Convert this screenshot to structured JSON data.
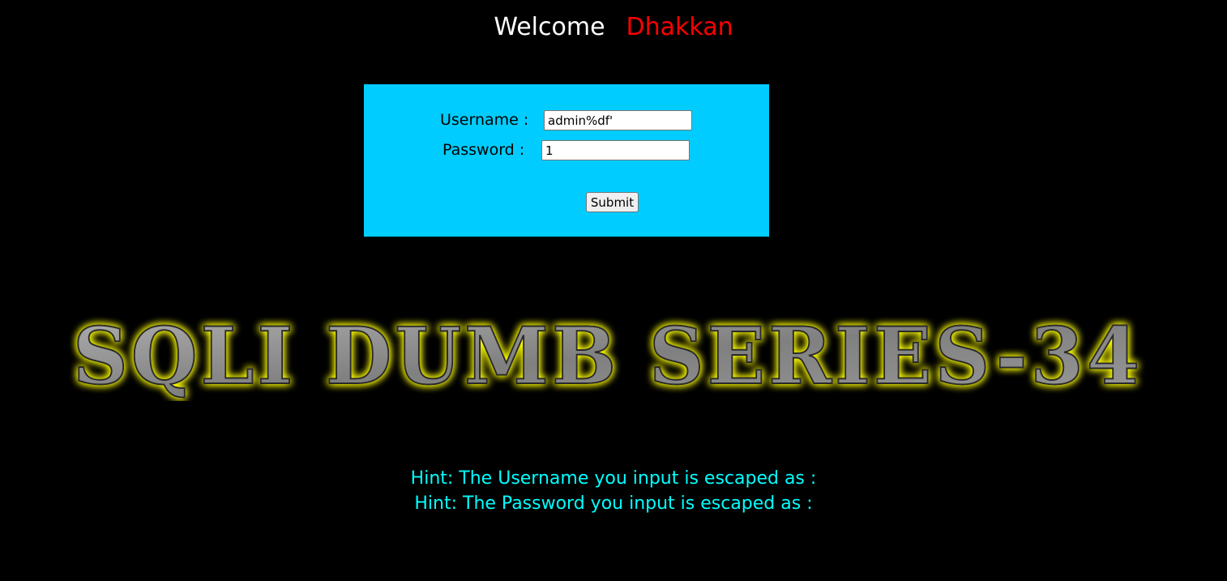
{
  "header": {
    "welcome": "Welcome",
    "name": "Dhakkan"
  },
  "form": {
    "username_label": "Username :",
    "password_label": "Password :",
    "username_value": "admin%df'",
    "password_value": "1",
    "submit_label": "Submit",
    "background_color": "#00ccff"
  },
  "banner": {
    "text": "SQLI DUMB SERIES-34",
    "fill_color": "#8a8a8a",
    "glow_color": "#ffff00"
  },
  "hints": {
    "username_hint": "Hint: The Username you input is escaped as :",
    "password_hint": "Hint: The Password you input is escaped as :"
  },
  "colors": {
    "page_background": "#000000",
    "welcome_text": "#ffffff",
    "name_text": "#ff0000",
    "hint_text": "#00ffff"
  }
}
